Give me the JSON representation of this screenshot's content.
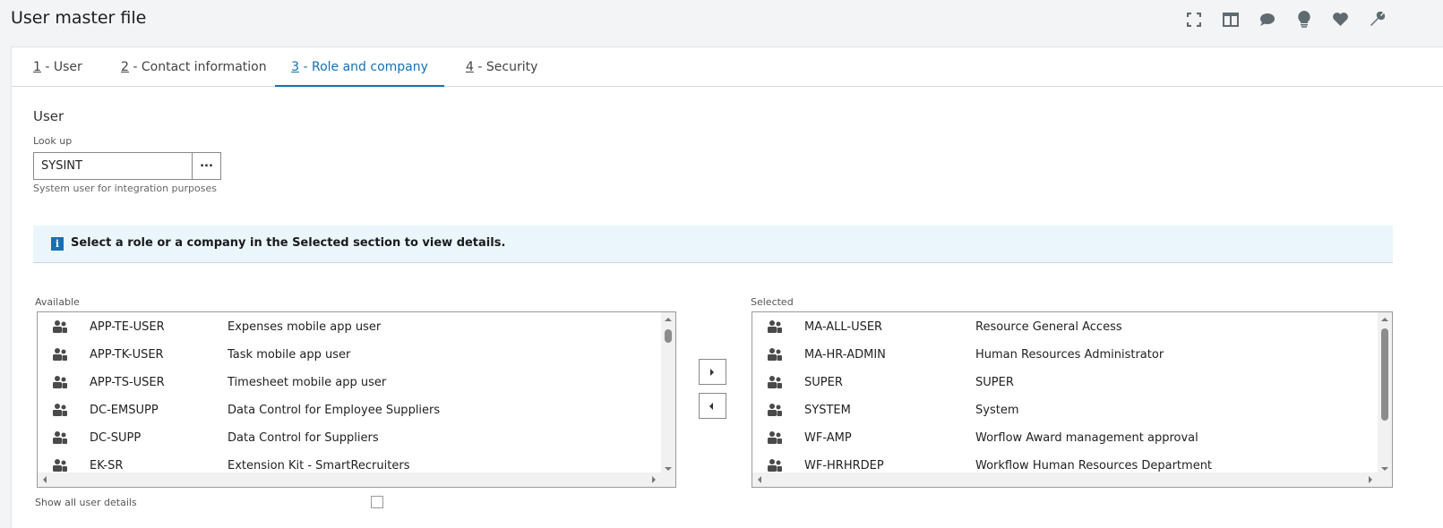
{
  "header": {
    "title": "User master file",
    "icons": [
      "fullscreen-icon",
      "layout-icon",
      "comment-icon",
      "lightbulb-icon",
      "heart-icon",
      "wrench-icon"
    ]
  },
  "tabs": [
    {
      "num": "1",
      "label": " - User"
    },
    {
      "num": "2",
      "label": " - Contact information"
    },
    {
      "num": "3",
      "label": " - Role and company"
    },
    {
      "num": "4",
      "label": " - Security"
    }
  ],
  "user": {
    "section": "User",
    "lookup_label": "Look up",
    "lookup_value": "SYSINT",
    "lookup_button": "...",
    "description": "System user for integration purposes"
  },
  "info": {
    "icon": "i",
    "text": "Select a role or a company in the Selected section to view details."
  },
  "available": {
    "label": "Available",
    "items": [
      {
        "code": "APP-TE-USER",
        "desc": "Expenses mobile app user"
      },
      {
        "code": "APP-TK-USER",
        "desc": "Task mobile app user"
      },
      {
        "code": "APP-TS-USER",
        "desc": "Timesheet mobile app user"
      },
      {
        "code": "DC-EMSUPP",
        "desc": "Data Control for Employee Suppliers"
      },
      {
        "code": "DC-SUPP",
        "desc": "Data Control for Suppliers"
      },
      {
        "code": "EK-SR",
        "desc": "Extension Kit - SmartRecruiters"
      }
    ]
  },
  "selected": {
    "label": "Selected",
    "items": [
      {
        "code": "MA-ALL-USER",
        "desc": "Resource General Access"
      },
      {
        "code": "MA-HR-ADMIN",
        "desc": "Human Resources Administrator"
      },
      {
        "code": "SUPER",
        "desc": "SUPER"
      },
      {
        "code": "SYSTEM",
        "desc": "System"
      },
      {
        "code": "WF-AMP",
        "desc": "Worflow Award management approval"
      },
      {
        "code": "WF-HRHRDEP",
        "desc": "Workflow Human Resources Department"
      }
    ]
  },
  "show_all": {
    "label": "Show all user details",
    "checked": false
  }
}
